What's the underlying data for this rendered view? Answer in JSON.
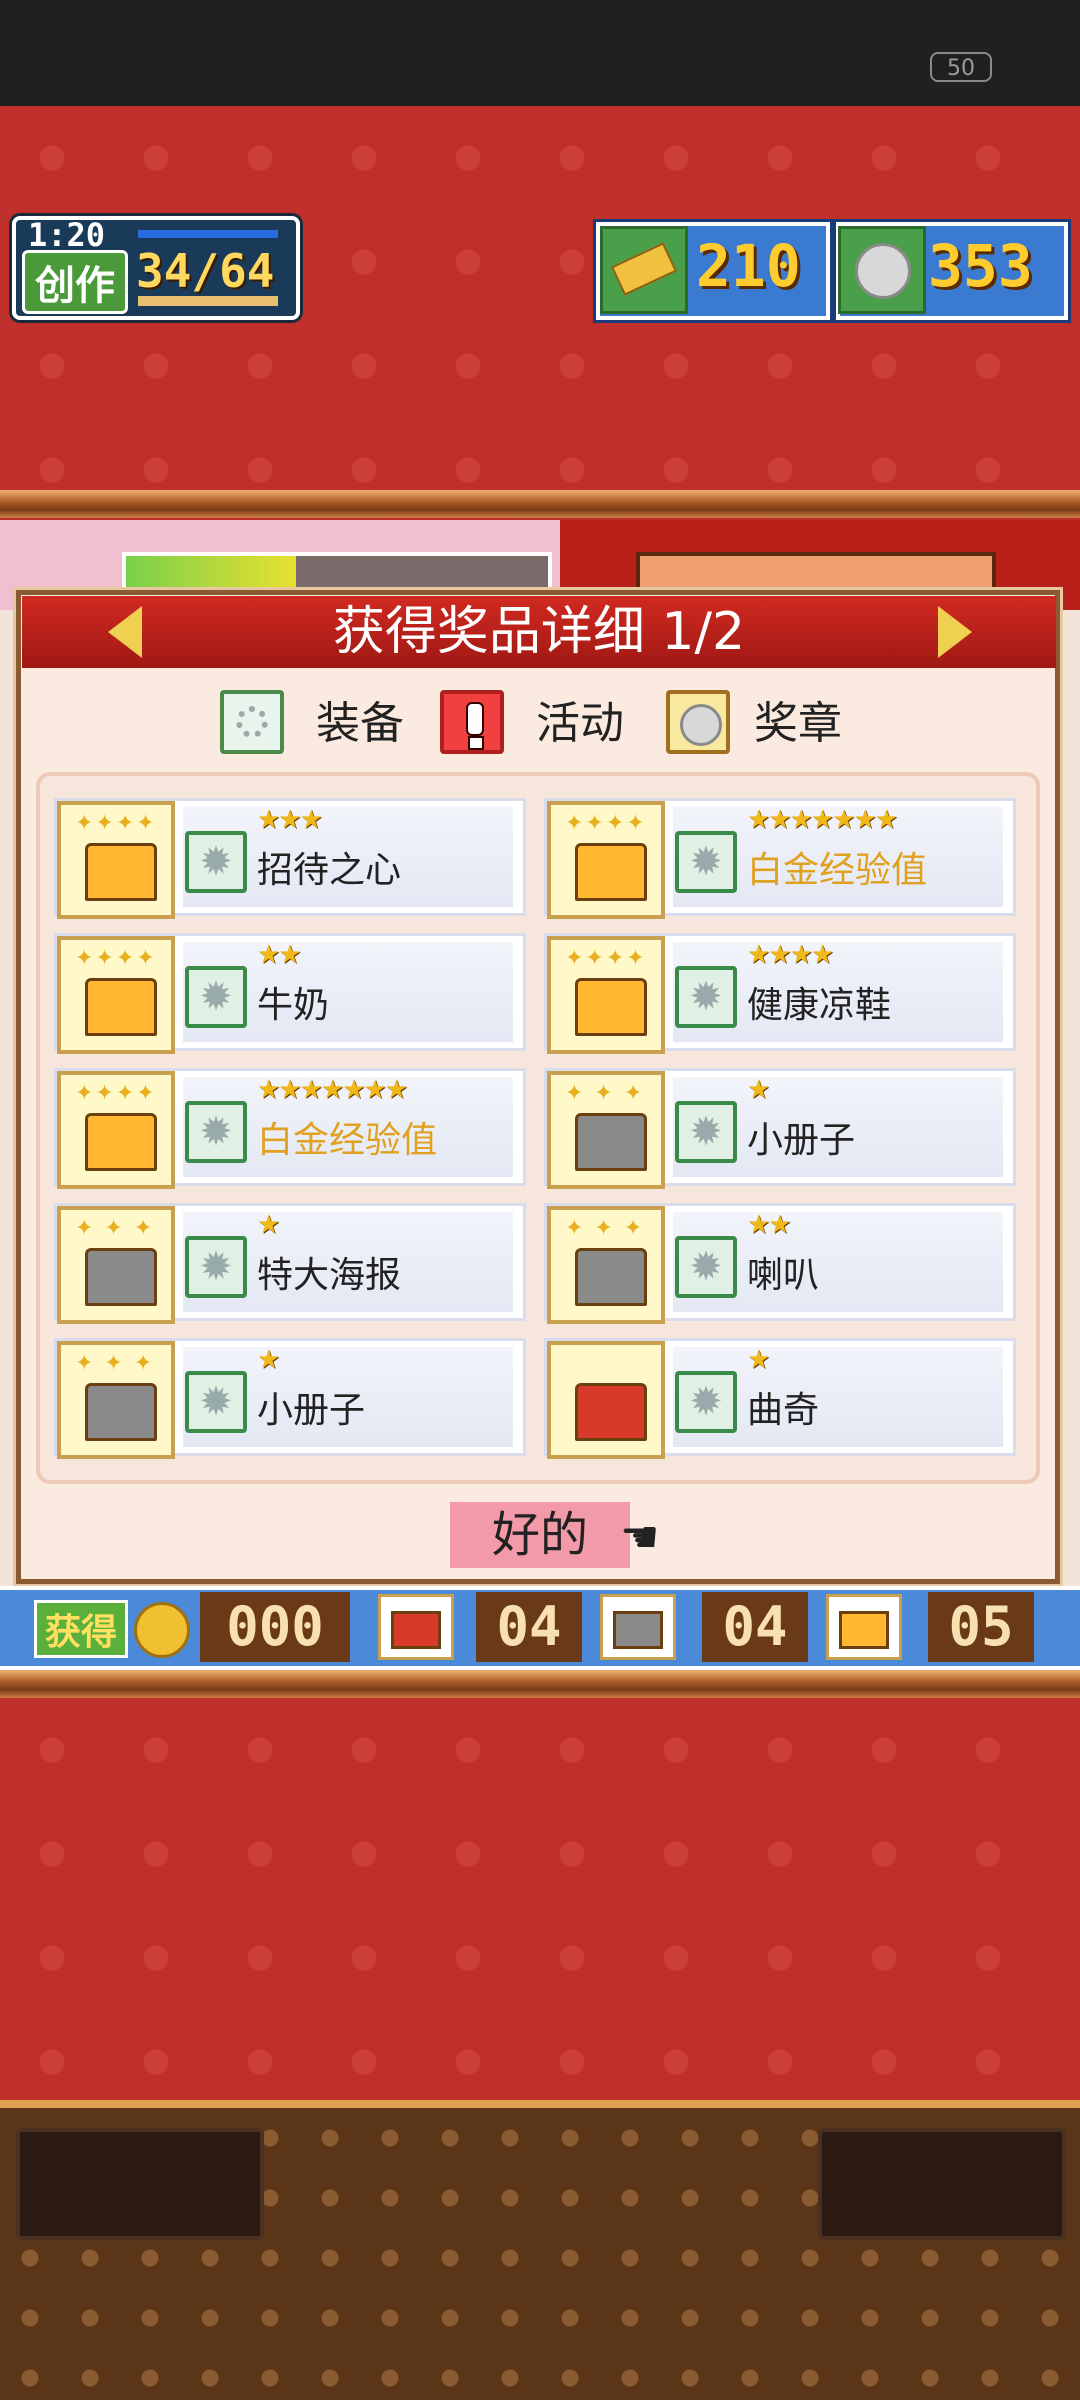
{
  "status_bar": {
    "battery": "50"
  },
  "hud": {
    "time": "1:20",
    "mode_label": "创作",
    "progress": "34/64",
    "currencies": [
      {
        "icon": "gold-bar-icon",
        "value": "210"
      },
      {
        "icon": "silver-medal-icon",
        "value": "353"
      }
    ]
  },
  "dialog": {
    "title": "获得奖品详细 1/2",
    "legend": [
      {
        "icon": "gear-icon",
        "label": "装备"
      },
      {
        "icon": "exclamation-icon",
        "label": "活动"
      },
      {
        "icon": "medal-icon",
        "label": "奖章"
      }
    ],
    "items": [
      {
        "chest": "gold",
        "stars": "★★★",
        "name": "招待之心",
        "highlight": false
      },
      {
        "chest": "gold",
        "stars": "★★★★★★★",
        "name": "白金经验值",
        "highlight": true
      },
      {
        "chest": "gold",
        "stars": "★★",
        "name": "牛奶",
        "highlight": false
      },
      {
        "chest": "gold",
        "stars": "★★★★",
        "name": "健康凉鞋",
        "highlight": false
      },
      {
        "chest": "gold",
        "stars": "★★★★★★★",
        "name": "白金经验值",
        "highlight": true
      },
      {
        "chest": "silver",
        "stars": "★",
        "name": "小册子",
        "highlight": false
      },
      {
        "chest": "silver",
        "stars": "★",
        "name": "特大海报",
        "highlight": false
      },
      {
        "chest": "silver",
        "stars": "★★",
        "name": "喇叭",
        "highlight": false
      },
      {
        "chest": "silver",
        "stars": "★",
        "name": "小册子",
        "highlight": false
      },
      {
        "chest": "red",
        "stars": "★",
        "name": "曲奇",
        "highlight": false
      }
    ],
    "ok_label": "好的"
  },
  "counter_bar": {
    "label": "获得",
    "coin_count": "000",
    "red_chest_count": "04",
    "silver_chest_count": "04",
    "gold_chest_count": "05"
  },
  "colors": {
    "accent_red": "#c0302a",
    "gold_text": "#e0a020",
    "ok_button": "#f29aa8"
  }
}
